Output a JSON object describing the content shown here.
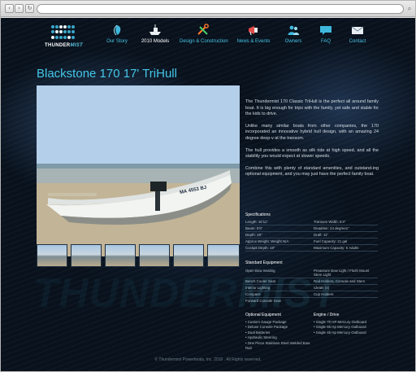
{
  "browser": {
    "back_icon": "chevron-left-icon",
    "forward_icon": "chevron-right-icon",
    "reload_icon": "reload-icon",
    "back_glyph": "‹",
    "forward_glyph": "›",
    "reload_glyph": "↻",
    "search_glyph": "⌕",
    "url": ""
  },
  "logo": {
    "name_part1": "THUNDER",
    "name_part2": "MIST"
  },
  "menu": [
    {
      "label": "Our Story",
      "icon": "leaf-icon"
    },
    {
      "label": "2010 Models",
      "icon": "boat-icon"
    },
    {
      "label": "Design & Construction",
      "icon": "tools-icon"
    },
    {
      "label": "News & Events",
      "icon": "megaphone-icon"
    },
    {
      "label": "Owners",
      "icon": "people-icon"
    },
    {
      "label": "FAQ",
      "icon": "speech-bubble-icon"
    },
    {
      "label": "Contact",
      "icon": "envelope-icon"
    }
  ],
  "page_title": "Blackstone 170 17' TriHull",
  "hull_number": "MA 4553 BJ",
  "description": [
    "The Thundermist 170 Classic TriHull is the perfect all around family boat. It is big enough for trips with the family, yet safe and stable for the kids to drive.",
    "Unlike many similar boats from other companies, the 170 incorporated an innovative hybrid hull design, with an amazing 24 degree deep-v at the transom.",
    "The hull provides a smooth as silk ride at high speed, and all the stability you would expect at slower speeds.",
    "Combine this with plenty of standard amenities, and outstand-ing optional equipment, and you may just have the perfect family boat."
  ],
  "specifications": {
    "heading": "Specifications",
    "rows": [
      [
        "Length: 16'11\"",
        "Transom Width: 5'4\""
      ],
      [
        "Beam: 5'6\"",
        "Deadrise: 24 degrees\""
      ],
      [
        "Depth: 29\"",
        "Draft: 11\""
      ],
      [
        "Approx Weight: Weight N/A",
        "Fuel Capacity: 21 gal"
      ],
      [
        "Cockpit Depth: 18\"",
        "Maximum Capacity: 6 Adults"
      ]
    ]
  },
  "standard_equipment": {
    "heading": "Standard Equipment",
    "rows": [
      [
        "Open Bow Seating",
        "Preassure Bow Light / Flush Mount Stern Light"
      ],
      [
        "Bench Cooler Seat",
        "Rod Holders, Console and Stern"
      ],
      [
        "Interior Lighting",
        "Cleats (4)"
      ],
      [
        "Compass",
        "Cup Holders"
      ],
      [
        "Forward Console Seat",
        ""
      ]
    ]
  },
  "optional_equipment": {
    "heading": "Optional Equipment",
    "items": [
      "Custom Gauge Package",
      "Deluxe Console Package",
      "Dual Batteries",
      "Hydraulic Steering",
      "One Piece Stainless Steel Welded Bow Rail"
    ]
  },
  "engine_drive": {
    "heading": "Engine / Drive",
    "items": [
      "Single 70 HP Mercury Outboard",
      "Single 65 Hp Mercury Outboard",
      "Single 45 Hp Mercury Outboard"
    ]
  },
  "watermark": {
    "part1": "THUNDER",
    "part2": "MIST"
  },
  "footer": "© Thundermist Powerboats, Inc. 2010 . All Rights reserved.",
  "colors": {
    "accent": "#44c6e8",
    "background": "#08111c",
    "text": "#d5dde4"
  }
}
